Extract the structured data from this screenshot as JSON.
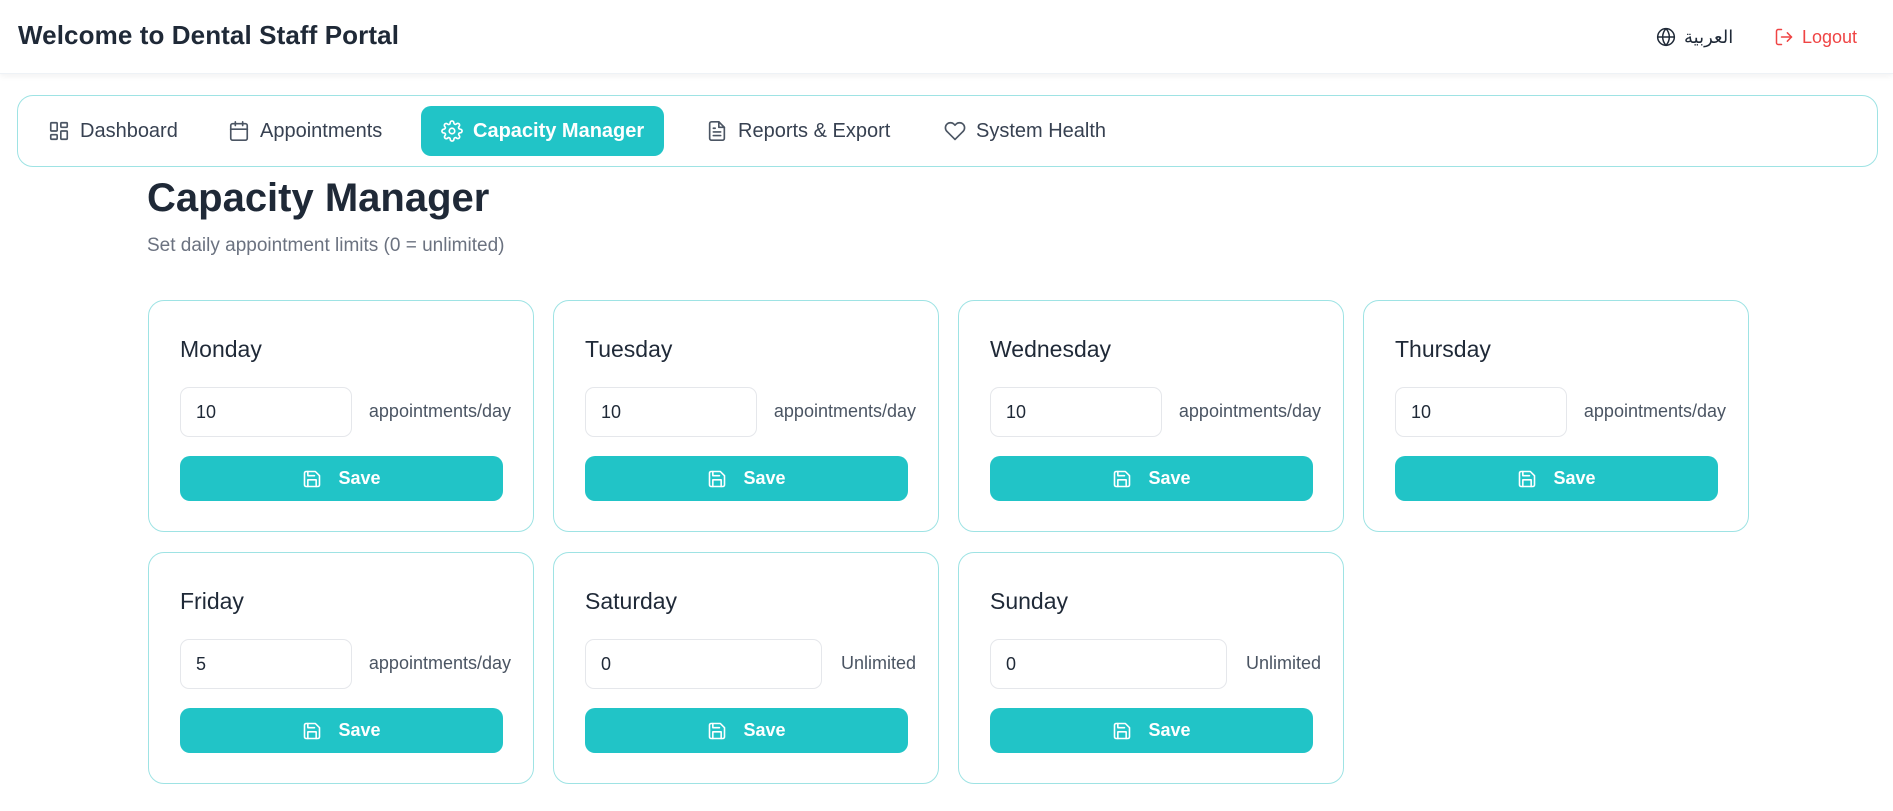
{
  "header": {
    "title": "Welcome to Dental Staff Portal",
    "language_label": "العربية",
    "language_icon": "globe-icon",
    "logout_label": "Logout",
    "logout_icon": "logout-icon",
    "logout_color": "#ef4444"
  },
  "nav": {
    "accent": "#21c4c7",
    "items": [
      {
        "label": "Dashboard",
        "icon": "dashboard-grid-icon",
        "active": false
      },
      {
        "label": "Appointments",
        "icon": "calendar-icon",
        "active": false
      },
      {
        "label": "Capacity Manager",
        "icon": "gear-icon",
        "active": true
      },
      {
        "label": "Reports & Export",
        "icon": "document-icon",
        "active": false
      },
      {
        "label": "System Health",
        "icon": "heart-icon",
        "active": false
      }
    ]
  },
  "page": {
    "title": "Capacity Manager",
    "subtitle": "Set daily appointment limits (0 = unlimited)"
  },
  "capacity": {
    "save_label": "Save",
    "save_icon": "save-icon",
    "days": [
      {
        "day": "Monday",
        "value": "10",
        "unit": "appointments/day"
      },
      {
        "day": "Tuesday",
        "value": "10",
        "unit": "appointments/day"
      },
      {
        "day": "Wednesday",
        "value": "10",
        "unit": "appointments/day"
      },
      {
        "day": "Thursday",
        "value": "10",
        "unit": "appointments/day"
      },
      {
        "day": "Friday",
        "value": "5",
        "unit": "appointments/day"
      },
      {
        "day": "Saturday",
        "value": "0",
        "unit": "Unlimited"
      },
      {
        "day": "Sunday",
        "value": "0",
        "unit": "Unlimited"
      }
    ]
  }
}
